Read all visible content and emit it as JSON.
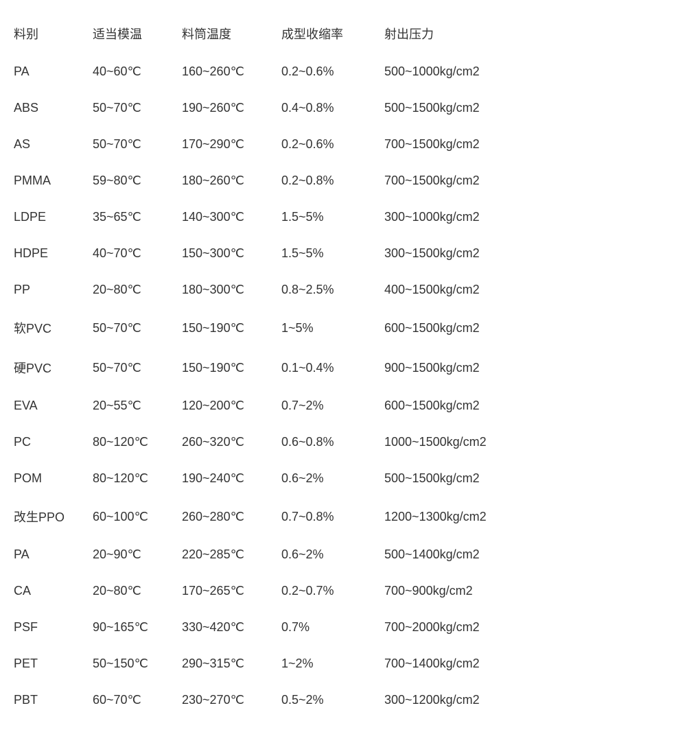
{
  "table": {
    "headers": [
      "料别",
      "适当模温",
      "料筒温度",
      "成型收缩率",
      "射出压力"
    ],
    "rows": [
      [
        "PA",
        "40~60℃",
        "160~260℃",
        "0.2~0.6%",
        "500~1000kg/cm2"
      ],
      [
        "ABS",
        "50~70℃",
        "190~260℃",
        "0.4~0.8%",
        "500~1500kg/cm2"
      ],
      [
        "AS",
        "50~70℃",
        "170~290℃",
        "0.2~0.6%",
        "700~1500kg/cm2"
      ],
      [
        "PMMA",
        "59~80℃",
        "180~260℃",
        "0.2~0.8%",
        "700~1500kg/cm2"
      ],
      [
        "LDPE",
        "35~65℃",
        "140~300℃",
        "1.5~5%",
        "300~1000kg/cm2"
      ],
      [
        "HDPE",
        "40~70℃",
        "150~300℃",
        "1.5~5%",
        "300~1500kg/cm2"
      ],
      [
        "PP",
        "20~80℃",
        "180~300℃",
        "0.8~2.5%",
        "400~1500kg/cm2"
      ],
      [
        "软PVC",
        "50~70℃",
        "150~190℃",
        "1~5%",
        "600~1500kg/cm2"
      ],
      [
        "硬PVC",
        "50~70℃",
        "150~190℃",
        "0.1~0.4%",
        "900~1500kg/cm2"
      ],
      [
        "EVA",
        "20~55℃",
        "120~200℃",
        "0.7~2%",
        "600~1500kg/cm2"
      ],
      [
        "PC",
        "80~120℃",
        "260~320℃",
        "0.6~0.8%",
        "1000~1500kg/cm2"
      ],
      [
        "POM",
        "80~120℃",
        "190~240℃",
        "0.6~2%",
        "500~1500kg/cm2"
      ],
      [
        "改生PPO",
        "60~100℃",
        "260~280℃",
        "0.7~0.8%",
        "1200~1300kg/cm2"
      ],
      [
        "PA",
        "20~90℃",
        "220~285℃",
        "0.6~2%",
        "500~1400kg/cm2"
      ],
      [
        "CA",
        "20~80℃",
        "170~265℃",
        "0.2~0.7%",
        "700~900kg/cm2"
      ],
      [
        "PSF",
        "90~165℃",
        "330~420℃",
        "0.7%",
        "700~2000kg/cm2"
      ],
      [
        "PET",
        "50~150℃",
        "290~315℃",
        "1~2%",
        "700~1400kg/cm2"
      ],
      [
        "PBT",
        "60~70℃",
        "230~270℃",
        "0.5~2%",
        "300~1200kg/cm2"
      ]
    ]
  }
}
